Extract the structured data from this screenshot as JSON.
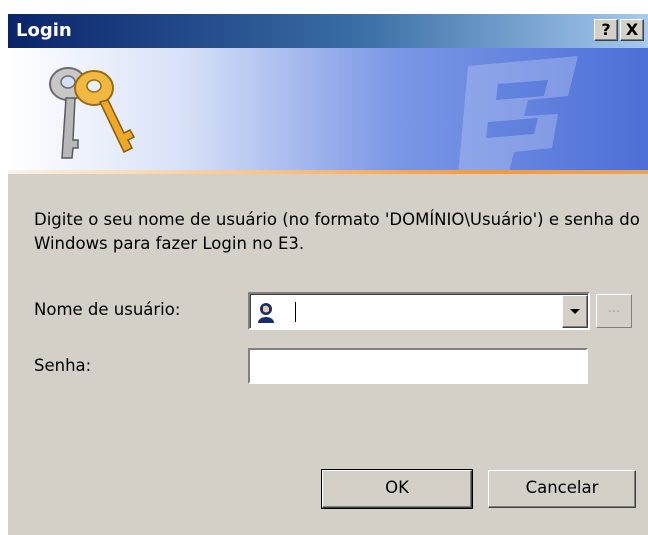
{
  "window": {
    "title": "Login",
    "help_label": "?",
    "close_label": "X"
  },
  "banner": {
    "icon": "keys-icon",
    "watermark_icon": "e3-logo-watermark"
  },
  "instruction": "Digite o seu nome de usuário (no formato 'DOMÍNIO\\Usuário') e senha do Windows para fazer Login no E3.",
  "username": {
    "label": "Nome de usuário:",
    "value": "",
    "icon": "user-icon",
    "browse_label": "..."
  },
  "password": {
    "label": "Senha:",
    "value": ""
  },
  "buttons": {
    "ok": "OK",
    "cancel": "Cancelar"
  },
  "colors": {
    "titlebar_start": "#0a246a",
    "dialog_bg": "#d4d0c8",
    "banner_accent": "#f39a3a"
  }
}
